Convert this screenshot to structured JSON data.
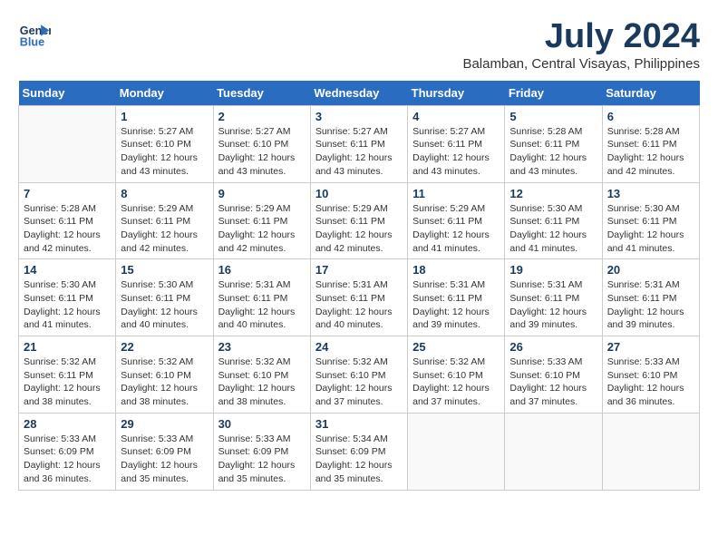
{
  "header": {
    "logo_line1": "General",
    "logo_line2": "Blue",
    "month": "July 2024",
    "location": "Balamban, Central Visayas, Philippines"
  },
  "weekdays": [
    "Sunday",
    "Monday",
    "Tuesday",
    "Wednesday",
    "Thursday",
    "Friday",
    "Saturday"
  ],
  "weeks": [
    [
      {
        "day": "",
        "info": ""
      },
      {
        "day": "1",
        "info": "Sunrise: 5:27 AM\nSunset: 6:10 PM\nDaylight: 12 hours\nand 43 minutes."
      },
      {
        "day": "2",
        "info": "Sunrise: 5:27 AM\nSunset: 6:10 PM\nDaylight: 12 hours\nand 43 minutes."
      },
      {
        "day": "3",
        "info": "Sunrise: 5:27 AM\nSunset: 6:11 PM\nDaylight: 12 hours\nand 43 minutes."
      },
      {
        "day": "4",
        "info": "Sunrise: 5:27 AM\nSunset: 6:11 PM\nDaylight: 12 hours\nand 43 minutes."
      },
      {
        "day": "5",
        "info": "Sunrise: 5:28 AM\nSunset: 6:11 PM\nDaylight: 12 hours\nand 43 minutes."
      },
      {
        "day": "6",
        "info": "Sunrise: 5:28 AM\nSunset: 6:11 PM\nDaylight: 12 hours\nand 42 minutes."
      }
    ],
    [
      {
        "day": "7",
        "info": "Sunrise: 5:28 AM\nSunset: 6:11 PM\nDaylight: 12 hours\nand 42 minutes."
      },
      {
        "day": "8",
        "info": "Sunrise: 5:29 AM\nSunset: 6:11 PM\nDaylight: 12 hours\nand 42 minutes."
      },
      {
        "day": "9",
        "info": "Sunrise: 5:29 AM\nSunset: 6:11 PM\nDaylight: 12 hours\nand 42 minutes."
      },
      {
        "day": "10",
        "info": "Sunrise: 5:29 AM\nSunset: 6:11 PM\nDaylight: 12 hours\nand 42 minutes."
      },
      {
        "day": "11",
        "info": "Sunrise: 5:29 AM\nSunset: 6:11 PM\nDaylight: 12 hours\nand 41 minutes."
      },
      {
        "day": "12",
        "info": "Sunrise: 5:30 AM\nSunset: 6:11 PM\nDaylight: 12 hours\nand 41 minutes."
      },
      {
        "day": "13",
        "info": "Sunrise: 5:30 AM\nSunset: 6:11 PM\nDaylight: 12 hours\nand 41 minutes."
      }
    ],
    [
      {
        "day": "14",
        "info": "Sunrise: 5:30 AM\nSunset: 6:11 PM\nDaylight: 12 hours\nand 41 minutes."
      },
      {
        "day": "15",
        "info": "Sunrise: 5:30 AM\nSunset: 6:11 PM\nDaylight: 12 hours\nand 40 minutes."
      },
      {
        "day": "16",
        "info": "Sunrise: 5:31 AM\nSunset: 6:11 PM\nDaylight: 12 hours\nand 40 minutes."
      },
      {
        "day": "17",
        "info": "Sunrise: 5:31 AM\nSunset: 6:11 PM\nDaylight: 12 hours\nand 40 minutes."
      },
      {
        "day": "18",
        "info": "Sunrise: 5:31 AM\nSunset: 6:11 PM\nDaylight: 12 hours\nand 39 minutes."
      },
      {
        "day": "19",
        "info": "Sunrise: 5:31 AM\nSunset: 6:11 PM\nDaylight: 12 hours\nand 39 minutes."
      },
      {
        "day": "20",
        "info": "Sunrise: 5:31 AM\nSunset: 6:11 PM\nDaylight: 12 hours\nand 39 minutes."
      }
    ],
    [
      {
        "day": "21",
        "info": "Sunrise: 5:32 AM\nSunset: 6:11 PM\nDaylight: 12 hours\nand 38 minutes."
      },
      {
        "day": "22",
        "info": "Sunrise: 5:32 AM\nSunset: 6:10 PM\nDaylight: 12 hours\nand 38 minutes."
      },
      {
        "day": "23",
        "info": "Sunrise: 5:32 AM\nSunset: 6:10 PM\nDaylight: 12 hours\nand 38 minutes."
      },
      {
        "day": "24",
        "info": "Sunrise: 5:32 AM\nSunset: 6:10 PM\nDaylight: 12 hours\nand 37 minutes."
      },
      {
        "day": "25",
        "info": "Sunrise: 5:32 AM\nSunset: 6:10 PM\nDaylight: 12 hours\nand 37 minutes."
      },
      {
        "day": "26",
        "info": "Sunrise: 5:33 AM\nSunset: 6:10 PM\nDaylight: 12 hours\nand 37 minutes."
      },
      {
        "day": "27",
        "info": "Sunrise: 5:33 AM\nSunset: 6:10 PM\nDaylight: 12 hours\nand 36 minutes."
      }
    ],
    [
      {
        "day": "28",
        "info": "Sunrise: 5:33 AM\nSunset: 6:09 PM\nDaylight: 12 hours\nand 36 minutes."
      },
      {
        "day": "29",
        "info": "Sunrise: 5:33 AM\nSunset: 6:09 PM\nDaylight: 12 hours\nand 35 minutes."
      },
      {
        "day": "30",
        "info": "Sunrise: 5:33 AM\nSunset: 6:09 PM\nDaylight: 12 hours\nand 35 minutes."
      },
      {
        "day": "31",
        "info": "Sunrise: 5:34 AM\nSunset: 6:09 PM\nDaylight: 12 hours\nand 35 minutes."
      },
      {
        "day": "",
        "info": ""
      },
      {
        "day": "",
        "info": ""
      },
      {
        "day": "",
        "info": ""
      }
    ]
  ]
}
